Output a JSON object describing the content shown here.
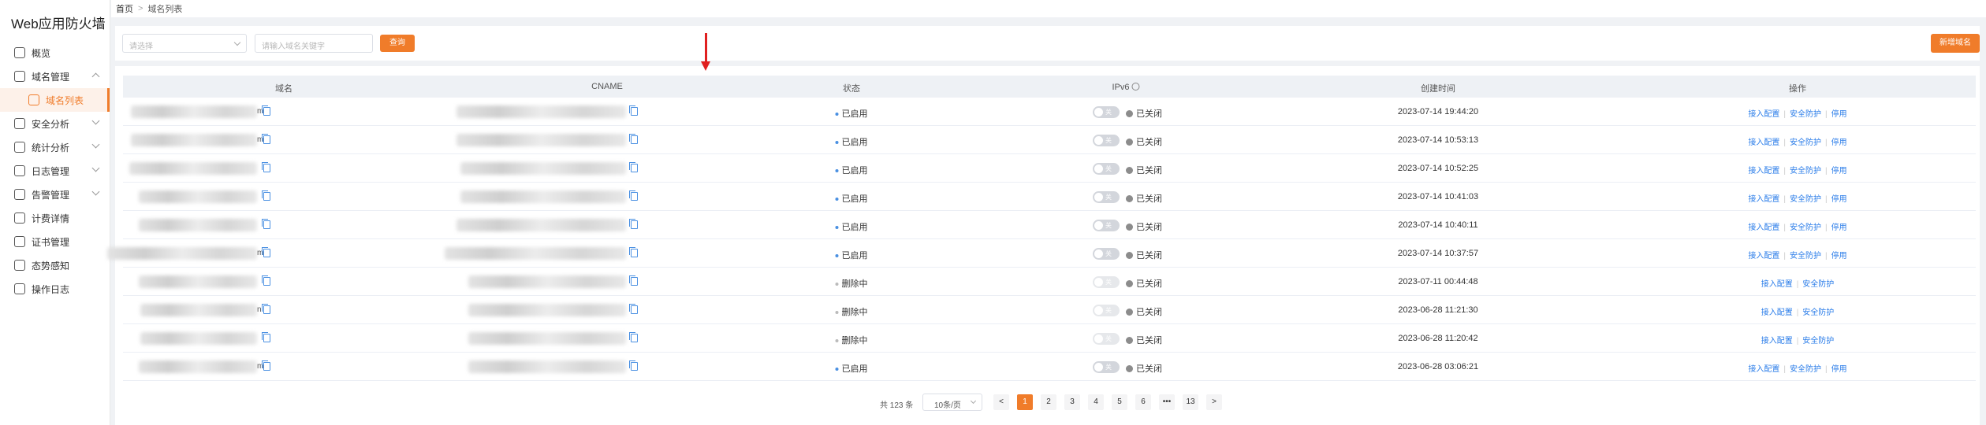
{
  "app": {
    "title": "Web应用防火墙"
  },
  "sidebar": {
    "items": [
      {
        "label": "概览",
        "icon": "dashboard-icon"
      },
      {
        "label": "域名管理",
        "icon": "globe-icon",
        "expanded": true
      },
      {
        "label": "域名列表",
        "icon": "list-icon",
        "active": true,
        "sub": true
      },
      {
        "label": "安全分析",
        "icon": "shield-icon",
        "chevron": true
      },
      {
        "label": "统计分析",
        "icon": "chart-icon",
        "chevron": true
      },
      {
        "label": "日志管理",
        "icon": "log-icon",
        "chevron": true
      },
      {
        "label": "告警管理",
        "icon": "alarm-icon",
        "chevron": true
      },
      {
        "label": "计费详情",
        "icon": "bill-icon"
      },
      {
        "label": "证书管理",
        "icon": "cert-icon"
      },
      {
        "label": "态势感知",
        "icon": "radar-icon"
      },
      {
        "label": "操作日志",
        "icon": "edit-log-icon"
      }
    ]
  },
  "breadcrumb": {
    "home": "首页",
    "sep": ">",
    "current": "域名列表"
  },
  "toolbar": {
    "select_placeholder": "请选择",
    "search_placeholder": "请输入域名关键字",
    "query_label": "查询",
    "add_label": "新增域名"
  },
  "table": {
    "columns": [
      "域名",
      "CNAME",
      "状态",
      "IPv6",
      "创建时间",
      "操作"
    ],
    "rows": [
      {
        "domain_tail": "m",
        "cname_tail": "",
        "status": "已启用",
        "ipv6": "已关闭",
        "created": "2023-07-14 19:44:20",
        "ops": [
          "接入配置",
          "安全防护",
          "停用"
        ]
      },
      {
        "domain_tail": "m",
        "cname_tail": "",
        "status": "已启用",
        "ipv6": "已关闭",
        "created": "2023-07-14 10:53:13",
        "ops": [
          "接入配置",
          "安全防护",
          "停用"
        ]
      },
      {
        "domain_tail": "",
        "cname_tail": "",
        "status": "已启用",
        "ipv6": "已关闭",
        "created": "2023-07-14 10:52:25",
        "ops": [
          "接入配置",
          "安全防护",
          "停用"
        ]
      },
      {
        "domain_tail": "",
        "cname_tail": "",
        "status": "已启用",
        "ipv6": "已关闭",
        "created": "2023-07-14 10:41:03",
        "ops": [
          "接入配置",
          "安全防护",
          "停用"
        ]
      },
      {
        "domain_tail": "",
        "cname_tail": "",
        "status": "已启用",
        "ipv6": "已关闭",
        "created": "2023-07-14 10:40:11",
        "ops": [
          "接入配置",
          "安全防护",
          "停用"
        ]
      },
      {
        "domain_tail": "m",
        "cname_tail": "",
        "status": "已启用",
        "ipv6": "已关闭",
        "created": "2023-07-14 10:37:57",
        "ops": [
          "接入配置",
          "安全防护",
          "停用"
        ]
      },
      {
        "domain_tail": "",
        "cname_tail": "",
        "status": "删除中",
        "ipv6": "已关闭",
        "created": "2023-07-11 00:44:48",
        "ops": [
          "接入配置",
          "安全防护"
        ]
      },
      {
        "domain_tail": "n",
        "cname_tail": "",
        "status": "删除中",
        "ipv6": "已关闭",
        "created": "2023-06-28 11:21:30",
        "ops": [
          "接入配置",
          "安全防护"
        ]
      },
      {
        "domain_tail": "",
        "cname_tail": "",
        "status": "删除中",
        "ipv6": "已关闭",
        "created": "2023-06-28 11:20:42",
        "ops": [
          "接入配置",
          "安全防护"
        ]
      },
      {
        "domain_tail": "m",
        "cname_tail": "",
        "status": "已启用",
        "ipv6": "已关闭",
        "created": "2023-06-28 03:06:21",
        "ops": [
          "接入配置",
          "安全防护",
          "停用"
        ]
      }
    ],
    "toggle_label": "关"
  },
  "pagination": {
    "total": "共 123 条",
    "page_size": "10条/页",
    "prev": "<",
    "next": ">",
    "pages": [
      "1",
      "2",
      "3",
      "4",
      "5",
      "6",
      "•••",
      "13"
    ],
    "current": "1"
  },
  "colors": {
    "accent": "#f07c2a",
    "link": "#2b7de9",
    "annotation_arrow": "#e02020"
  }
}
